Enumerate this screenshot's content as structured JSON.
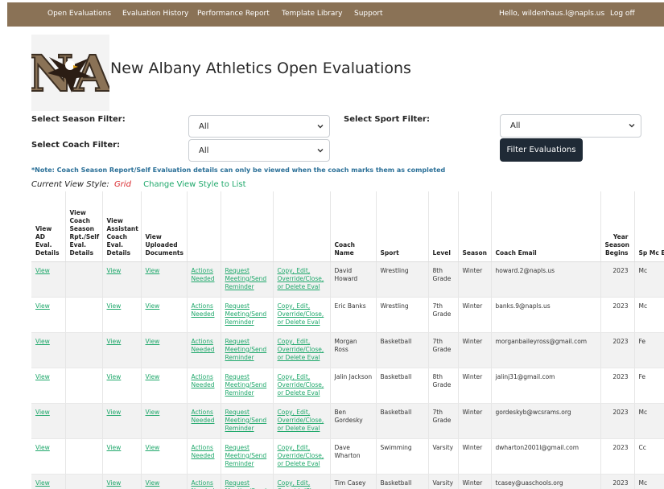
{
  "navbar": {
    "items": [
      "Open Evaluations",
      "Evaluation History",
      "Performance Report",
      "Template Library",
      "Support"
    ],
    "greeting": "Hello, wildenhaus.l@napls.us",
    "logoff": "Log off"
  },
  "header": {
    "logo_text": "NA",
    "title": "New Albany Athletics Open Evaluations"
  },
  "filters": {
    "season_label": "Select Season Filter:",
    "season_value": "All",
    "sport_label": "Select Sport Filter:",
    "sport_value": "All",
    "coach_label": "Select Coach Filter:",
    "coach_value": "All",
    "button": "Filter Evaluations"
  },
  "note": "*Note: Coach Season Report/Self Evaluation details can only be viewed when the coach marks them as completed",
  "view_style": {
    "label": "Current View Style:",
    "current": "Grid",
    "change": "Change View Style to List"
  },
  "table": {
    "headers": [
      "View AD Eval. Details",
      "View Coach Season Rpt./Self Eval. Details",
      "View Assistant Coach Eval. Details",
      "View Uploaded Documents",
      "",
      "",
      "",
      "Coach Name",
      "Sport",
      "Level",
      "Season",
      "Coach Email",
      "Year Season Begins",
      "Sp Mc Ed"
    ],
    "link_labels": {
      "view": "View",
      "actions": "Actions Needed",
      "request": "Request Meeting/Send Reminder",
      "copy": "Copy, Edit, Override/Close, or Delete Eval"
    },
    "rows": [
      {
        "coach": "David Howard",
        "sport": "Wrestling",
        "level": "8th Grade",
        "season": "Winter",
        "email": "howard.2@napls.us",
        "year": "2023",
        "extra": "Mc"
      },
      {
        "coach": "Eric Banks",
        "sport": "Wrestling",
        "level": "7th Grade",
        "season": "Winter",
        "email": "banks.9@napls.us",
        "year": "2023",
        "extra": "Mc"
      },
      {
        "coach": "Morgan Ross",
        "sport": "Basketball",
        "level": "7th Grade",
        "season": "Winter",
        "email": "morganbaileyross@gmail.com",
        "year": "2023",
        "extra": "Fe"
      },
      {
        "coach": "Jalin Jackson",
        "sport": "Basketball",
        "level": "8th Grade",
        "season": "Winter",
        "email": "jalinj31@gmail.com",
        "year": "2023",
        "extra": "Fe"
      },
      {
        "coach": "Ben Gordesky",
        "sport": "Basketball",
        "level": "7th Grade",
        "season": "Winter",
        "email": "gordeskyb@wcsrams.org",
        "year": "2023",
        "extra": "Mc"
      },
      {
        "coach": "Dave Wharton",
        "sport": "Swimming",
        "level": "Varsity",
        "season": "Winter",
        "email": "dwharton2001l@gmail.com",
        "year": "2023",
        "extra": "Cc"
      },
      {
        "coach": "Tim Casey",
        "sport": "Basketball",
        "level": "Varsity",
        "season": "Winter",
        "email": "tcasey@uaschools.org",
        "year": "2023",
        "extra": "Mc"
      }
    ]
  }
}
